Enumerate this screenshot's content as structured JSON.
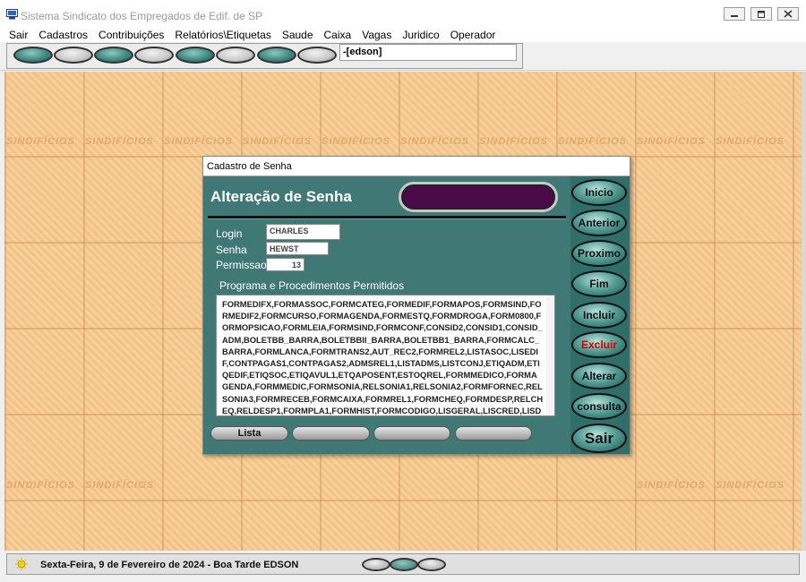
{
  "window": {
    "title": "Sistema Sindicato dos Empregados de Edif. de SP"
  },
  "menu": [
    "Sair",
    "Cadastros",
    "Contribuições",
    "Relatórios\\Etiquetas",
    "Saude",
    "Caixa",
    "Vagas",
    "Juridico",
    "Operador"
  ],
  "toolbar": {
    "user": "-[edson]"
  },
  "desktop": {
    "watermark": "SINDIFÍCIOS"
  },
  "dialog": {
    "title": "Cadastro de Senha",
    "heading": "Alteração de Senha",
    "fields": {
      "login_label": "Login",
      "login_value": "CHARLES",
      "senha_label": "Senha",
      "senha_value": "HEWST",
      "permissao_label": "Permissao",
      "permissao_value": "13"
    },
    "programs_label": "Programa e Procedimentos Permitidos",
    "programs_text": "FORMEDIFX,FORMASSOC,FORMCATEG,FORMEDIF,FORMAPOS,FORMSIND,FORMEDIF2,FORMCURSO,FORMAGENDA,FORMESTQ,FORMDROGA,FORM0800,FORMOPSICAO,FORMLEIA,FORMSIND,FORMCONF,CONSID2,CONSID1,CONSID_ADM,BOLETBB_BARRA,BOLETBBII_BARRA,BOLETBB1_BARRA,FORMCALC_BARRA,FORMLANCA,FORMTRANS2,AUT_REC2,FORMREL2,LISTASOC,LISEDIF,CONTPAGAS1,CONTPAGAS2,ADMSREL1,LISTADMS,LISTCONJ,ETIQADM,ETIQEDIF,ETIQSOC,ETIQAVUL1,ETQAPOSENT,ESTOQREL,FORMMEDICO,FORMAGENDA,FORMMEDIC,FORMSONIA,RELSONIA1,RELSONIA2,FORMFORNEC,RELSONIA3,FORMRECEB,FORMCAIXA,FORMREL1,FORMCHEQ,FORMDESP,RELCHEQ,RELDESP1,FORMPLA1,FORMHIST,FORMCODIGO,LISGERAL,LISCRED,LISDEB,LISHIS,FORMVAGAS,FORMVA",
    "lower_buttons": [
      "Lista",
      "",
      "",
      ""
    ],
    "side_buttons": [
      "Inicio",
      "Anterior",
      "Proximo",
      "Fim",
      "Incluir",
      "Excluir",
      "Alterar",
      "consulta",
      "Sair"
    ]
  },
  "status": {
    "text": "Sexta-Feira,  9 de Fevereiro de 2024 - Boa Tarde  EDSON"
  },
  "colors": {
    "dialog_bg": "#3f7874",
    "desktop_bg": "#f6c98e",
    "excluir_text": "#d40000",
    "display_bg": "#4a0a4a"
  }
}
